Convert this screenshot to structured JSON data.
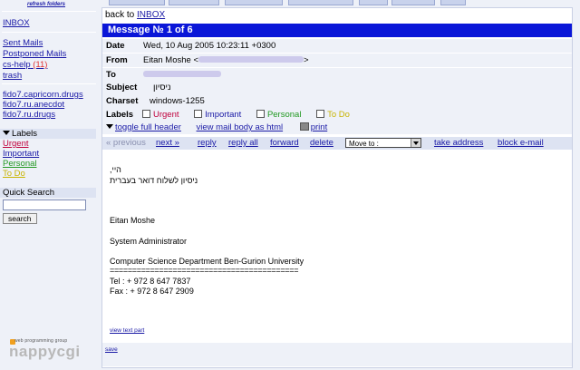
{
  "sidebar": {
    "refresh": "refresh folders",
    "inbox": "INBOX",
    "folders": [
      {
        "label": "Sent Mails",
        "count": ""
      },
      {
        "label": "Postponed Mails",
        "count": ""
      },
      {
        "label": "cs-help",
        "count": "(11)"
      },
      {
        "label": "trash",
        "count": ""
      }
    ],
    "newsgroups": [
      "fido7.capricorn.drugs",
      "fido7.ru.anecdot",
      "fido7.ru.drugs"
    ],
    "labels_title": "Labels",
    "labels": [
      {
        "label": "Urgent",
        "color": "#c0003c"
      },
      {
        "label": "Important",
        "color": "#1a1aa6"
      },
      {
        "label": "Personal",
        "color": "#229922"
      },
      {
        "label": "To Do",
        "color": "#c8b400"
      }
    ],
    "quick_search_title": "Quick Search",
    "search_button": "search",
    "logo_tagline": "web programming group",
    "logo_word": "nappycgi"
  },
  "main": {
    "back_prefix": "back to",
    "back_link": "INBOX",
    "message_title": "Message № 1 of 6",
    "headers": {
      "date_label": "Date",
      "date_value": "Wed, 10 Aug 2005 10:23:11 +0300",
      "from_label": "From",
      "from_name": "Eitan Moshe <",
      "from_close": ">",
      "to_label": "To",
      "subject_label": "Subject",
      "subject_value": "ניסיון",
      "charset_label": "Charset",
      "charset_value": "windows-1255",
      "labels_label": "Labels"
    },
    "toolbar": {
      "toggle": "toggle full header",
      "view_html": "view mail body as html",
      "print": "print"
    },
    "actions": {
      "previous": "« previous",
      "next": "next »",
      "reply": "reply",
      "reply_all": "reply all",
      "forward": "forward",
      "delete": "delete",
      "move_to": "Move to :",
      "take_address": "take address",
      "block": "block e-mail"
    },
    "body": {
      "greeting": "היי,",
      "line1": "ניסיון לשלוח דואר בעברית",
      "name": "Eitan Moshe",
      "title": "System Administrator",
      "dept": "Computer Science Department Ben-Gurion University",
      "rule": "==========================================",
      "tel": "Tel :  + 972  8 647 7837",
      "fax": "Fax :  + 972  8 647 2909"
    },
    "view_text_part": "view text part",
    "save": "save"
  }
}
